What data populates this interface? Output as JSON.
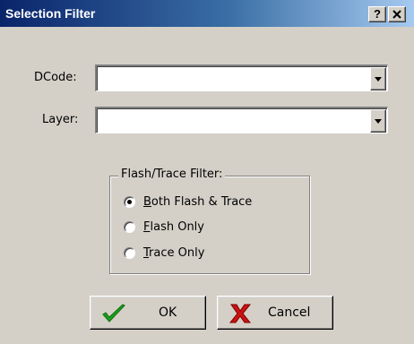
{
  "window": {
    "title": "Selection Filter",
    "help_button": "?",
    "close_icon": "close-icon"
  },
  "fields": {
    "dcode": {
      "label": "DCode:",
      "value": ""
    },
    "layer": {
      "label": "Layer:",
      "value": ""
    }
  },
  "filter_group": {
    "title": "Flash/Trace  Filter:",
    "options": [
      {
        "accel": "B",
        "rest": "oth Flash & Trace",
        "selected": true
      },
      {
        "accel": "F",
        "rest": "lash Only",
        "selected": false
      },
      {
        "accel": "T",
        "rest": "race Only",
        "selected": false
      }
    ]
  },
  "buttons": {
    "ok": {
      "label": "OK",
      "icon": "checkmark-icon",
      "icon_color": "#1f9e1f"
    },
    "cancel": {
      "label": "Cancel",
      "icon": "red-x-icon",
      "icon_color": "#cc1111"
    }
  }
}
